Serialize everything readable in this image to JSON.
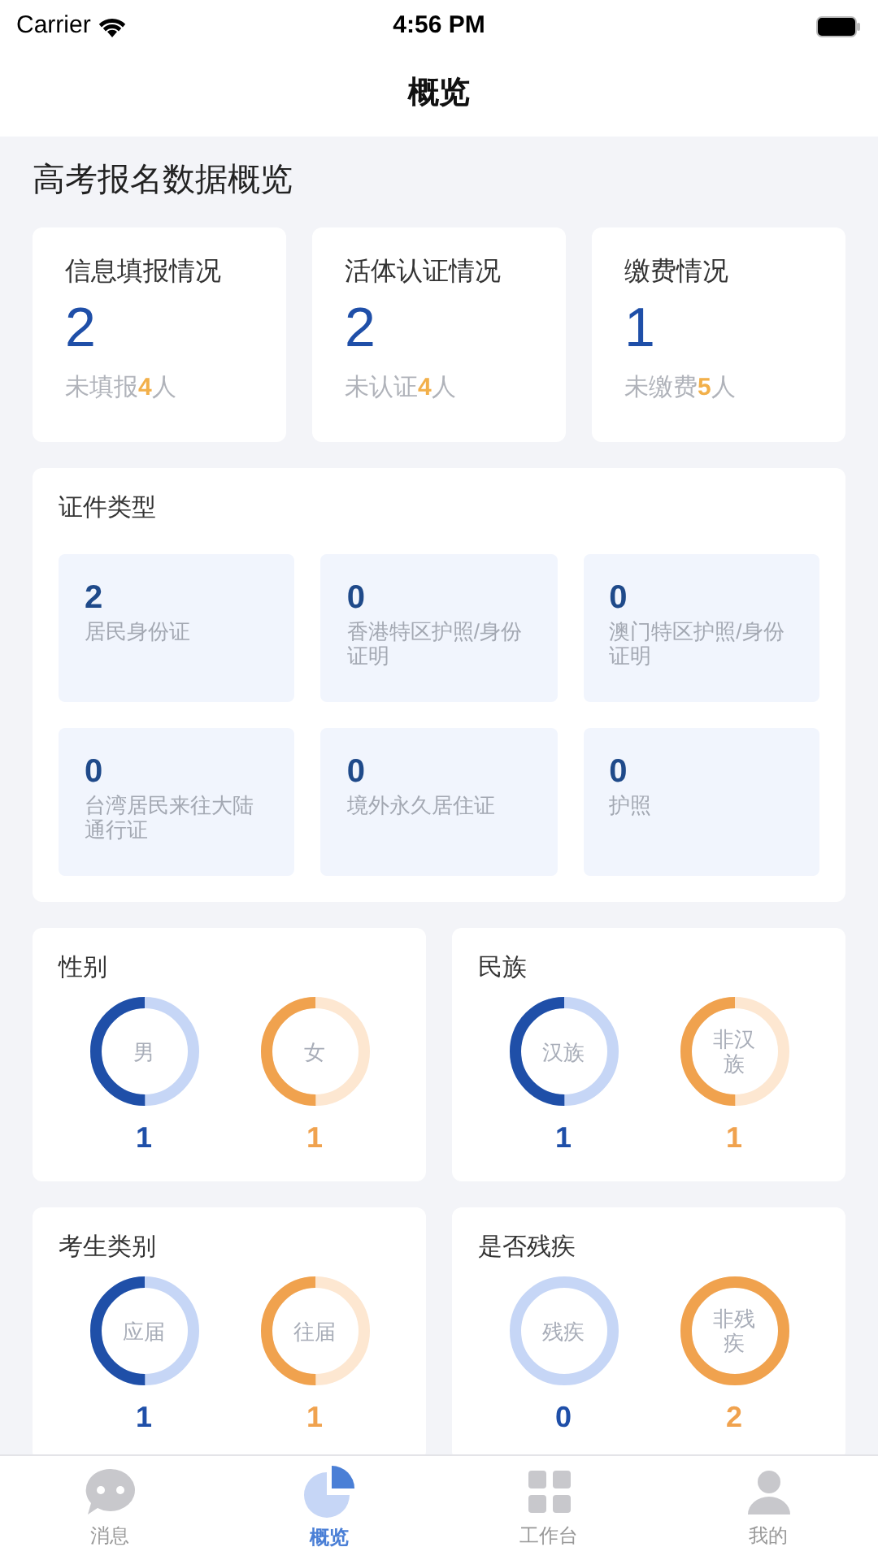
{
  "status_bar": {
    "carrier": "Carrier",
    "time": "4:56 PM"
  },
  "nav": {
    "title": "概览"
  },
  "section_title": "高考报名数据概览",
  "stat_cards": [
    {
      "title": "信息填报情况",
      "value": "2",
      "note_prefix": "未填报",
      "note_count": "4",
      "note_suffix": "人"
    },
    {
      "title": "活体认证情况",
      "value": "2",
      "note_prefix": "未认证",
      "note_count": "4",
      "note_suffix": "人"
    },
    {
      "title": "缴费情况",
      "value": "1",
      "note_prefix": "未缴费",
      "note_count": "5",
      "note_suffix": "人"
    }
  ],
  "id_types": {
    "title": "证件类型",
    "items": [
      {
        "value": "2",
        "label": "居民身份证"
      },
      {
        "value": "0",
        "label": "香港特区护照/身份证明"
      },
      {
        "value": "0",
        "label": "澳门特区护照/身份证明"
      },
      {
        "value": "0",
        "label": "台湾居民来往大陆通行证"
      },
      {
        "value": "0",
        "label": "境外永久居住证"
      },
      {
        "value": "0",
        "label": "护照"
      }
    ]
  },
  "charts": [
    {
      "title": "性别",
      "rings": [
        {
          "kind": "blue",
          "label": "男",
          "value": "1"
        },
        {
          "kind": "orange",
          "label": "女",
          "value": "1"
        }
      ]
    },
    {
      "title": "民族",
      "rings": [
        {
          "kind": "blue",
          "label": "汉族",
          "value": "1"
        },
        {
          "kind": "orange",
          "label": "非汉族",
          "value": "1"
        }
      ]
    },
    {
      "title": "考生类别",
      "rings": [
        {
          "kind": "blue",
          "label": "应届",
          "value": "1"
        },
        {
          "kind": "orange",
          "label": "往届",
          "value": "1"
        }
      ]
    },
    {
      "title": "是否残疾",
      "rings": [
        {
          "kind": "blue",
          "label": "残疾",
          "value": "0"
        },
        {
          "kind": "orange",
          "label": "非残疾",
          "value": "2"
        }
      ]
    }
  ],
  "tab_bar": [
    {
      "kind": "chat",
      "label": "消息",
      "selected": false
    },
    {
      "kind": "pie",
      "label": "概览",
      "selected": true
    },
    {
      "kind": "grid",
      "label": "工作台",
      "selected": false
    },
    {
      "kind": "person",
      "label": "我的",
      "selected": false
    }
  ]
}
